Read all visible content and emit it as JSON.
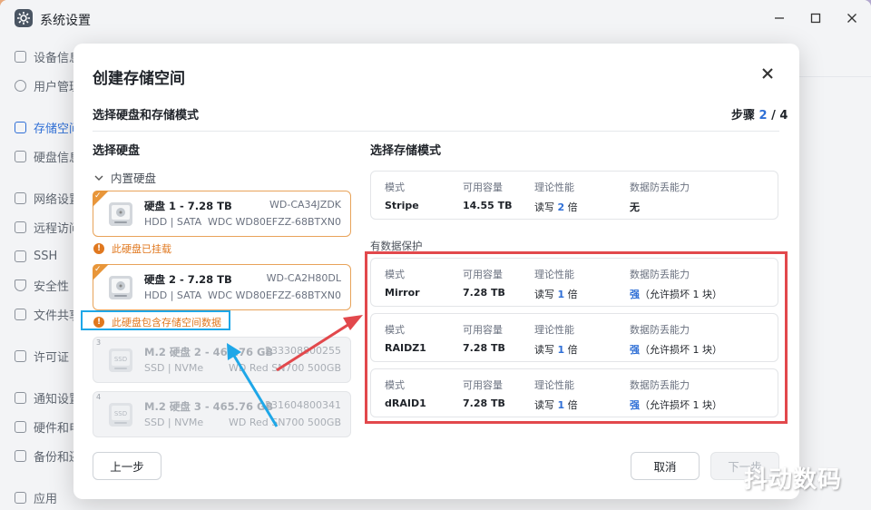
{
  "window": {
    "title": "系统设置"
  },
  "sidebar": {
    "items": [
      {
        "label": "设备信息"
      },
      {
        "label": "用户管理"
      },
      {
        "label": "存储空间"
      },
      {
        "label": "硬盘信息"
      },
      {
        "label": "网络设置"
      },
      {
        "label": "远程访问"
      },
      {
        "label": "SSH"
      },
      {
        "label": "安全性"
      },
      {
        "label": "文件共享"
      },
      {
        "label": "许可证"
      },
      {
        "label": "通知设置"
      },
      {
        "label": "硬件和电源"
      },
      {
        "label": "备份和还原"
      },
      {
        "label": "应用"
      }
    ]
  },
  "dialog": {
    "title": "创建存储空间",
    "subtitle": "选择硬盘和存储模式",
    "step_label": "步骤",
    "step_current": "2",
    "step_total": "/ 4",
    "left_title": "选择硬盘",
    "group_label": "内置硬盘",
    "disks": [
      {
        "name": "硬盘 1 - 7.28 TB",
        "serial": "WD-CA34JZDK",
        "type": "HDD | SATA",
        "model": "WDC WD80EFZZ-68BTXN0",
        "selected": true,
        "index": ""
      },
      {
        "name": "硬盘 2 - 7.28 TB",
        "serial": "WD-CA2H80DL",
        "type": "HDD | SATA",
        "model": "WDC WD80EFZZ-68BTXN0",
        "selected": true,
        "index": ""
      },
      {
        "name": "M.2 硬盘 2 - 465.76 GB",
        "serial": "233308800255",
        "type": "SSD | NVMe",
        "model": "WD Red SN700 500GB",
        "selected": false,
        "index": "3"
      },
      {
        "name": "M.2 硬盘 3 - 465.76 GB",
        "serial": "231604800341",
        "type": "SSD | NVMe",
        "model": "WD Red SN700 500GB",
        "selected": false,
        "index": "4"
      }
    ],
    "warnings": [
      "此硬盘已挂载",
      "此硬盘包含存储空间数据"
    ],
    "right_title": "选择存储模式",
    "section_label": "有数据保护",
    "mode_headers": {
      "mode": "模式",
      "capacity": "可用容量",
      "perf": "理论性能",
      "protect": "数据防丢能力"
    },
    "modes": [
      {
        "mode": "Stripe",
        "capacity": "14.55 TB",
        "perf_prefix": "读写 ",
        "perf_num": "2",
        "perf_suffix": " 倍",
        "protect_strong": "",
        "protect_text": "无"
      },
      {
        "mode": "Mirror",
        "capacity": "7.28 TB",
        "perf_prefix": "读写 ",
        "perf_num": "1",
        "perf_suffix": " 倍",
        "protect_strong": "强",
        "protect_text": "（允许损坏 1 块）"
      },
      {
        "mode": "RAIDZ1",
        "capacity": "7.28 TB",
        "perf_prefix": "读写 ",
        "perf_num": "1",
        "perf_suffix": " 倍",
        "protect_strong": "强",
        "protect_text": "（允许损坏 1 块）"
      },
      {
        "mode": "dRAID1",
        "capacity": "7.28 TB",
        "perf_prefix": "读写 ",
        "perf_num": "1",
        "perf_suffix": " 倍",
        "protect_strong": "强",
        "protect_text": "（允许损坏 1 块）"
      }
    ],
    "buttons": {
      "prev": "上一步",
      "cancel": "取消",
      "next": "下一步"
    }
  },
  "watermark": "抖动数码",
  "colors": {
    "accent": "#2f6fd6",
    "warning": "#e0781f",
    "selected_border": "#e8a35a",
    "annotation_red": "#e2484c",
    "annotation_blue": "#1ea7e8"
  }
}
